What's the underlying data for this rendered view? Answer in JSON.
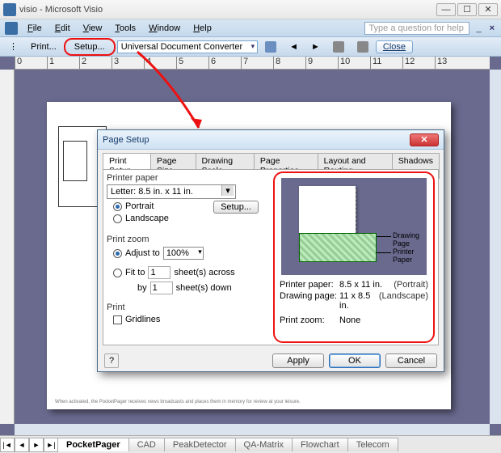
{
  "window": {
    "title": "visio - Microsoft Visio"
  },
  "menu": {
    "items": [
      "File",
      "Edit",
      "View",
      "Tools",
      "Window",
      "Help"
    ],
    "helpPlaceholder": "Type a question for help"
  },
  "toolbar": {
    "print": "Print...",
    "setup": "Setup...",
    "converter": "Universal Document Converter",
    "close": "Close"
  },
  "pageTabs": {
    "items": [
      "PocketPager",
      "CAD",
      "PeakDetector",
      "QA-Matrix",
      "Flowchart",
      "Telecom"
    ],
    "activeIndex": 0
  },
  "dialog": {
    "title": "Page Setup",
    "tabs": [
      "Print Setup",
      "Page Size",
      "Drawing Scale",
      "Page Properties",
      "Layout and Routing",
      "Shadows"
    ],
    "activeTab": 0,
    "printerPaper": {
      "label": "Printer paper",
      "size": "Letter: 8.5 in. x 11 in.",
      "portrait": "Portrait",
      "landscape": "Landscape",
      "orientation": "Portrait",
      "setupBtn": "Setup..."
    },
    "printZoom": {
      "label": "Print zoom",
      "adjustTo": "Adjust to",
      "adjustValue": "100%",
      "fitTo": "Fit to",
      "sheetsAcross": "sheet(s) across",
      "sheetsDown": "sheet(s) down",
      "by": "by",
      "acrossVal": "1",
      "downVal": "1"
    },
    "print": {
      "label": "Print",
      "gridlines": "Gridlines"
    },
    "preview": {
      "drawingPage": "Drawing Page",
      "printerPaper": "Printer Paper",
      "info": {
        "pp_k": "Printer paper:",
        "pp_v": "8.5 x 11 in.",
        "pp_o": "(Portrait)",
        "dp_k": "Drawing page:",
        "dp_v": "11 x 8.5 in.",
        "dp_o": "(Landscape)",
        "pz_k": "Print zoom:",
        "pz_v": "None"
      }
    },
    "buttons": {
      "apply": "Apply",
      "ok": "OK",
      "cancel": "Cancel"
    }
  },
  "ruler": [
    "0",
    "1",
    "2",
    "3",
    "4",
    "5",
    "6",
    "7",
    "8",
    "9",
    "10",
    "11",
    "12",
    "13"
  ]
}
